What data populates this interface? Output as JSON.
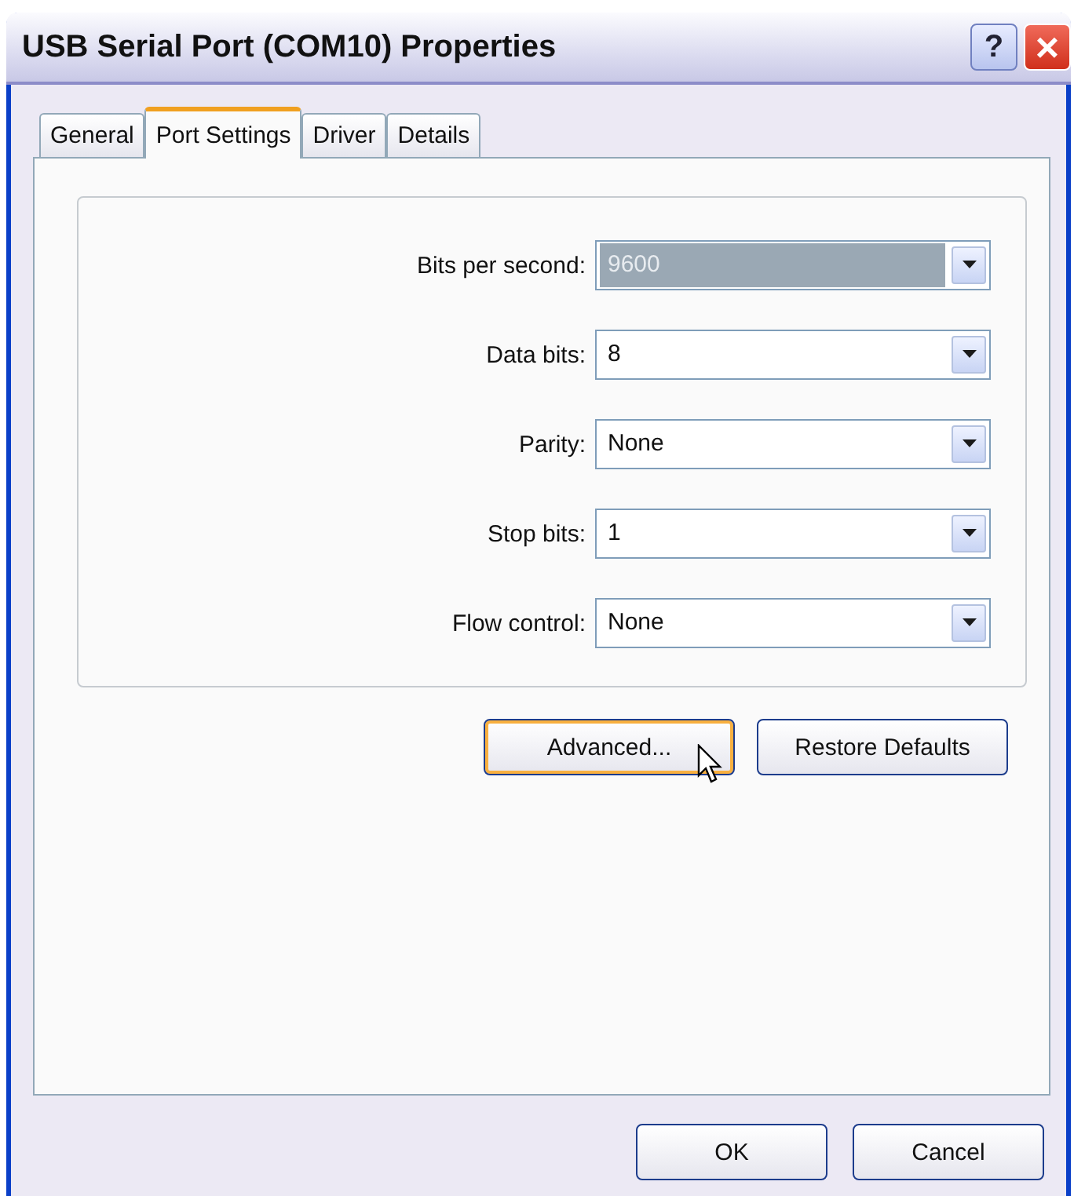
{
  "window": {
    "title": "USB Serial Port (COM10) Properties",
    "title_buttons": [
      {
        "kind": "help",
        "label": "?"
      },
      {
        "kind": "close",
        "label": "×"
      }
    ]
  },
  "tabs": [
    {
      "label": "General",
      "selected": false
    },
    {
      "label": "Port Settings",
      "selected": true
    },
    {
      "label": "Driver",
      "selected": false
    },
    {
      "label": "Details",
      "selected": false
    }
  ],
  "settings": [
    {
      "label": "Bits per second:",
      "value": "9600",
      "highlighted": true
    },
    {
      "label": "Data bits:",
      "value": "8",
      "highlighted": false
    },
    {
      "label": "Parity:",
      "value": "None",
      "highlighted": false
    },
    {
      "label": "Stop bits:",
      "value": "1",
      "highlighted": false
    },
    {
      "label": "Flow control:",
      "value": "None",
      "highlighted": false
    }
  ],
  "panel_buttons": [
    {
      "label": "Advanced...",
      "focused": true
    },
    {
      "label": "Restore Defaults",
      "focused": false
    }
  ],
  "dialog_buttons": [
    {
      "label": "OK",
      "focused": false
    },
    {
      "label": "Cancel",
      "focused": false
    }
  ]
}
